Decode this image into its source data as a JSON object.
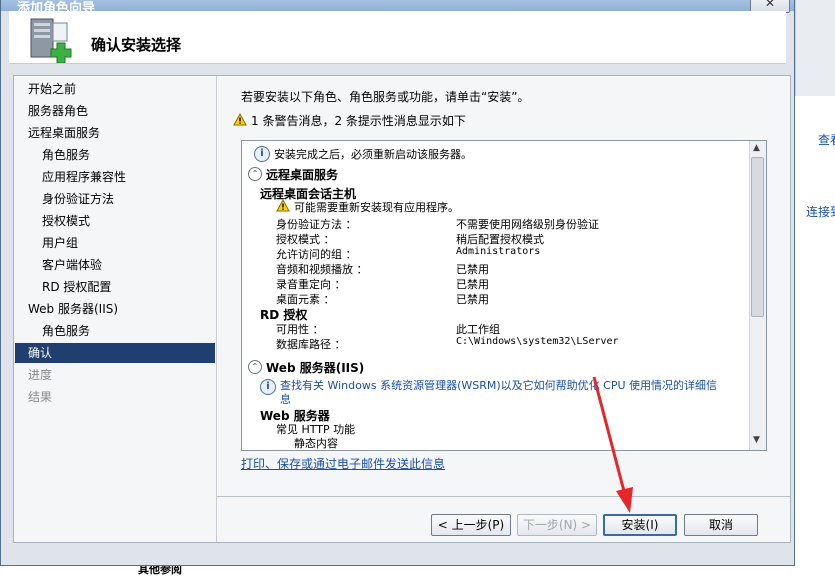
{
  "window": {
    "title": "添加角色向导",
    "close_label": "✕",
    "header_title": "确认安装选择"
  },
  "background": {
    "link_view": "查看",
    "link_connect": "连接到",
    "bottom_text": "其他参阅"
  },
  "sidebar": {
    "items": [
      {
        "label": "开始之前",
        "level": 0,
        "state": "normal"
      },
      {
        "label": "服务器角色",
        "level": 0,
        "state": "normal"
      },
      {
        "label": "远程桌面服务",
        "level": 0,
        "state": "normal"
      },
      {
        "label": "角色服务",
        "level": 1,
        "state": "normal"
      },
      {
        "label": "应用程序兼容性",
        "level": 1,
        "state": "normal"
      },
      {
        "label": "身份验证方法",
        "level": 1,
        "state": "normal"
      },
      {
        "label": "授权模式",
        "level": 1,
        "state": "normal"
      },
      {
        "label": "用户组",
        "level": 1,
        "state": "normal"
      },
      {
        "label": "客户端体验",
        "level": 1,
        "state": "normal"
      },
      {
        "label": "RD 授权配置",
        "level": 1,
        "state": "normal"
      },
      {
        "label": "Web 服务器(IIS)",
        "level": 0,
        "state": "normal"
      },
      {
        "label": "角色服务",
        "level": 1,
        "state": "normal"
      },
      {
        "label": "确认",
        "level": 0,
        "state": "active"
      },
      {
        "label": "进度",
        "level": 0,
        "state": "disabled"
      },
      {
        "label": "结果",
        "level": 0,
        "state": "disabled"
      }
    ]
  },
  "main": {
    "intro": "若要安装以下角色、角色服务或功能，请单击“安装”。",
    "warning_summary": "1 条警告消息，2 条提示性消息显示如下",
    "list": {
      "restart_notice": "安装完成之后，必须重新启动该服务器。",
      "section_rds": "远程桌面服务",
      "rdsh_title": "远程桌面会话主机",
      "rdsh_warning": "可能需要重新安装现有应用程序。",
      "rdsh_props": [
        {
          "key": "身份验证方法 ：",
          "value": "不需要使用网络级别身份验证"
        },
        {
          "key": "授权模式 ：",
          "value": "稍后配置授权模式"
        },
        {
          "key": "允许访问的组 ：",
          "value": "Administrators"
        },
        {
          "key": "音频和视频播放 ：",
          "value": "已禁用"
        },
        {
          "key": "录音重定向 ：",
          "value": "已禁用"
        },
        {
          "key": "桌面元素 ：",
          "value": "已禁用"
        }
      ],
      "rd_license_title": "RD 授权",
      "rd_license_props": [
        {
          "key": "可用性 ：",
          "value": "此工作组"
        },
        {
          "key": "数据库路径 ：",
          "value": "C:\\Windows\\system32\\LServer"
        }
      ],
      "section_iis": "Web 服务器(IIS)",
      "iis_info_line1": "查找有关 Windows 系统资源管理器(WSRM)以及它如何帮助优化 CPU 使用情况的详细信",
      "iis_info_line2": "息",
      "web_server_title": "Web 服务器",
      "common_http": "常见 HTTP 功能",
      "static_content": "静态内容"
    },
    "footer_link": "打印、保存或通过电子邮件发送此信息"
  },
  "buttons": {
    "prev": "< 上一步(P)",
    "next": "下一步(N) >",
    "install": "安装(I)",
    "cancel": "取消"
  }
}
